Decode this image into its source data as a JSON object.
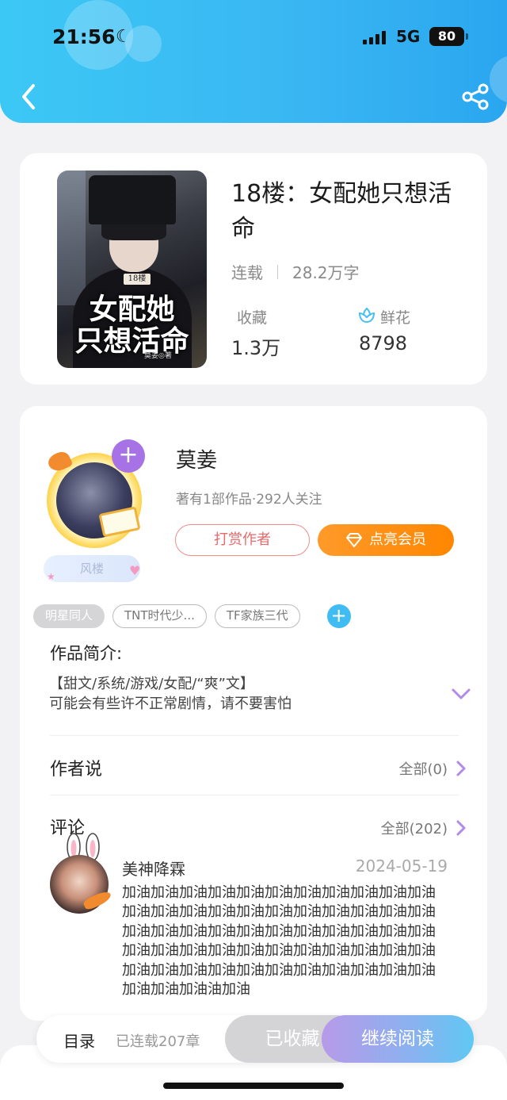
{
  "status_bar": {
    "time": "21:56",
    "network": "5G",
    "battery": "80"
  },
  "book": {
    "title": "18楼：女配她只想活命",
    "status": "连载",
    "word_count": "28.2万字",
    "favorites_label": "收藏",
    "favorites_value": "1.3万",
    "flowers_label": "鲜花",
    "flowers_value": "8798",
    "cover": {
      "badge": "18楼",
      "line1": "女配她",
      "line2": "只想活命",
      "author": "莫姜◎著"
    }
  },
  "author": {
    "name": "莫姜",
    "stats": "著有1部作品·292人关注",
    "badge": "风楼",
    "tip_label": "打赏作者",
    "vip_label": "点亮会员"
  },
  "tags": [
    "明星同人",
    "TNT时代少...",
    "TF家族三代"
  ],
  "intro": {
    "heading": "作品简介:",
    "line1": "【甜文/系统/游戏/女配/“爽”文】",
    "line2": "可能会有些许不正常剧情，请不要害怕"
  },
  "author_says": {
    "heading": "作者说",
    "link": "全部(0)"
  },
  "comments": {
    "heading": "评论",
    "link": "全部(202)",
    "first": {
      "user": "美神降霖",
      "date": "2024-05-19",
      "text": "加油加油加油加油加油加油加油加油加油加油加油加油加油加油加油加油加油加油加油加油加油加油加油加油加油加油加油加油加油加油加油加油加油加油加油加油加油加油加油加油加油加油加油加油加油加油加油加油加油加油加油加油加油加油加油加油加油加油油加油"
    }
  },
  "bottom_bar": {
    "toc_label": "目录",
    "chapters": "已连载207章",
    "faved_label": "已收藏",
    "read_label": "继续阅读"
  },
  "colors": {
    "accent": "#3cc8f5",
    "vip": "#ff8600",
    "purple": "#a772e6"
  }
}
